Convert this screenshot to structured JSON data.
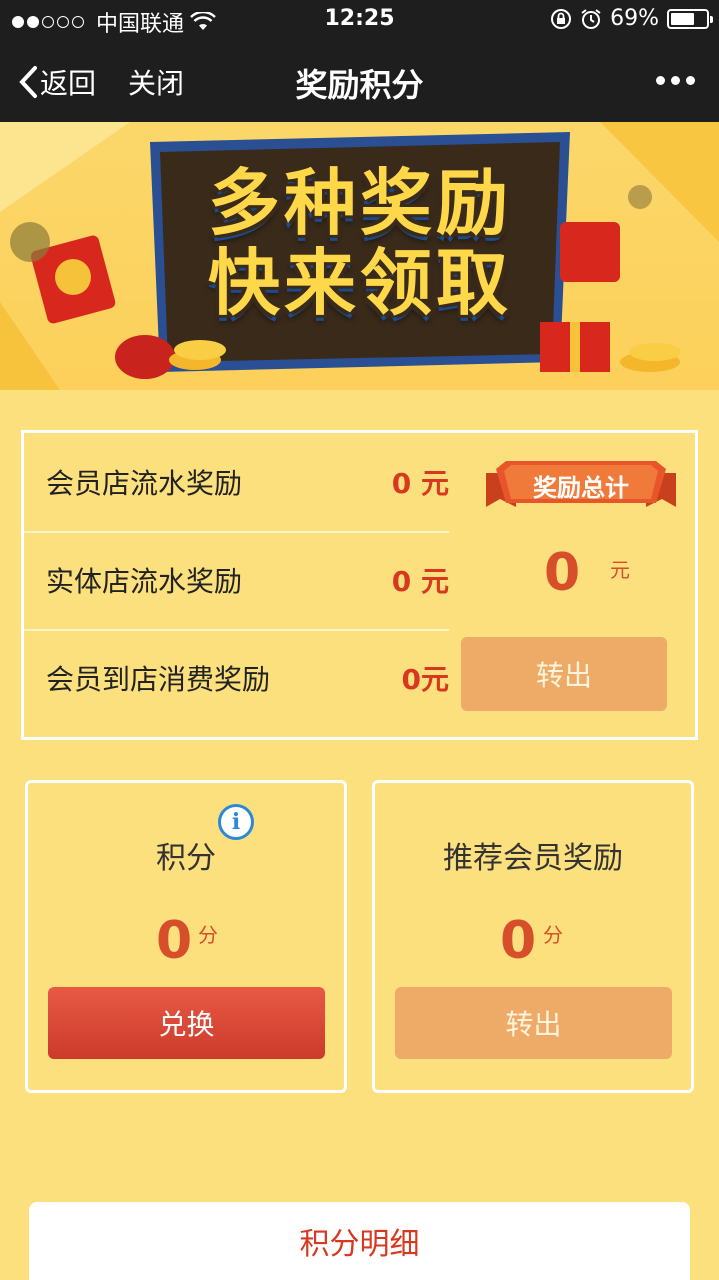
{
  "status_bar": {
    "carrier": "中国联通",
    "time": "12:25",
    "battery": "69%",
    "battery_level": 0.69,
    "signal_bars": 2
  },
  "nav": {
    "back_label": "返回",
    "close_label": "关闭",
    "title": "奖励积分"
  },
  "banner": {
    "line1": "多种奖励",
    "line2": "快来领取"
  },
  "reward_rows": [
    {
      "label": "会员店流水奖励",
      "value": "0 元"
    },
    {
      "label": "实体店流水奖励",
      "value": "0 元"
    },
    {
      "label": "会员到店消费奖励",
      "value": "0元"
    }
  ],
  "total": {
    "ribbon_label": "奖励总计",
    "value": "0",
    "unit": "元",
    "button_label": "转出"
  },
  "cards": [
    {
      "title": "积分",
      "amount": "0",
      "unit": "分",
      "button_label": "兑换"
    },
    {
      "title": "推荐会员奖励",
      "amount": "0",
      "unit": "分",
      "button_label": "转出"
    }
  ],
  "info_icon_glyph": "i",
  "detail_button_label": "积分明细",
  "colors": {
    "page_bg": "#fbe07d",
    "accent_red": "#d8381f",
    "button_orange": "#eeab67",
    "button_red": "#cc3a2a",
    "nav_bg": "#1e1e1e"
  }
}
